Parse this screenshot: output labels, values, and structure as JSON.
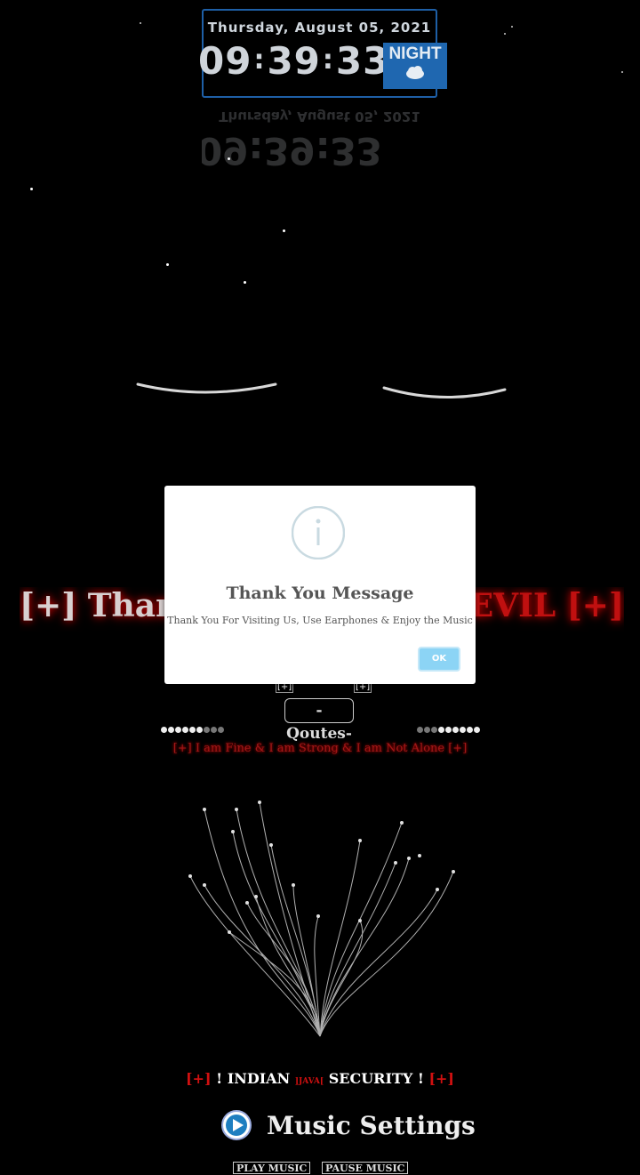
{
  "clock": {
    "date": "Thursday, August 05, 2021",
    "hours": "09",
    "minutes": "39",
    "seconds": "33",
    "separator": ":",
    "mode": "NIGHT",
    "weather_icon": "cloud-icon"
  },
  "background": {
    "heading_left": "[+] Thank Y",
    "heading_right": "DEVIL [+]",
    "glow_color": "#b00000"
  },
  "dialog": {
    "icon": "info-icon",
    "title": "Thank You Message",
    "message": "Thank You For Visiting Us, Use Earphones & Enjoy the Music",
    "ok_label": "OK",
    "ok_color": "#8cd4f5"
  },
  "quotes": {
    "bracket": "[+]",
    "tag": "-Qoutes-",
    "line": "[+] I am Fine & I am Strong & I am Not Alone [+]"
  },
  "footer": {
    "bracket_left": "[+]",
    "title_part1": "! INDIAN ",
    "title_small": "]JAVA[",
    "title_part2": " SECURITY !",
    "bracket_right": "[+]",
    "music_settings": "Music Settings",
    "play_music": "PLAY MUSIC",
    "pause_music": "PAUSE MUSIC"
  }
}
